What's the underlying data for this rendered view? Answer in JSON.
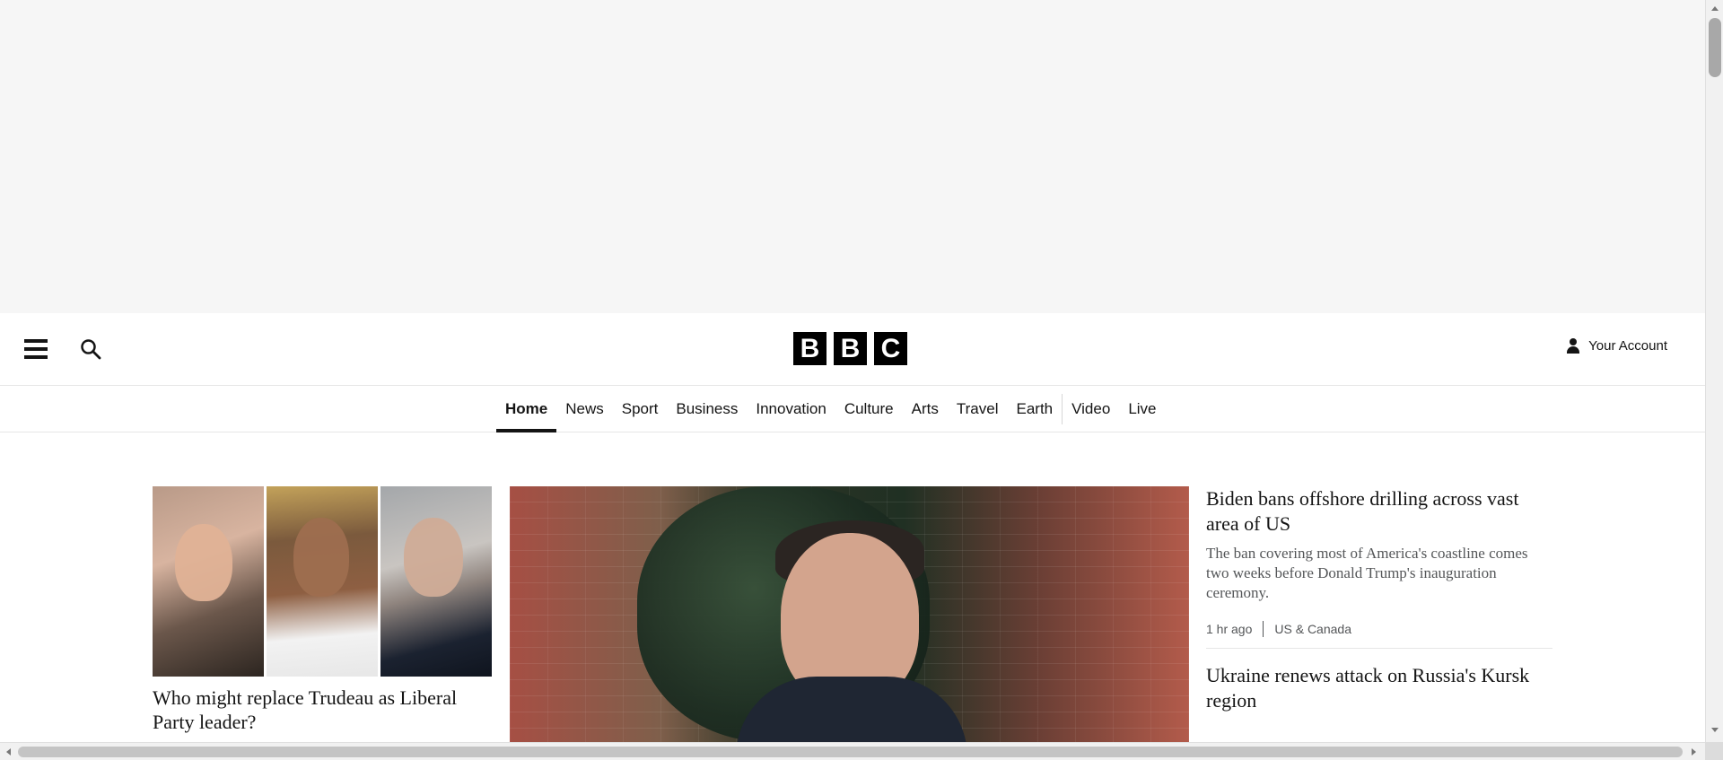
{
  "header": {
    "logo_letters": [
      "B",
      "B",
      "C"
    ],
    "account_label": "Your Account"
  },
  "nav": {
    "items": [
      {
        "label": "Home",
        "active": true
      },
      {
        "label": "News"
      },
      {
        "label": "Sport"
      },
      {
        "label": "Business"
      },
      {
        "label": "Innovation"
      },
      {
        "label": "Culture"
      },
      {
        "label": "Arts"
      },
      {
        "label": "Travel"
      },
      {
        "label": "Earth"
      },
      {
        "label": "Video"
      },
      {
        "label": "Live"
      }
    ]
  },
  "main": {
    "left_story": {
      "headline": "Who might replace Trudeau as Liberal Party leader?"
    },
    "side_stories": [
      {
        "headline": "Biden bans offshore drilling across vast area of US",
        "summary": "The ban covering most of America's coastline comes two weeks before Donald Trump's inauguration ceremony.",
        "time": "1 hr ago",
        "section": "US & Canada"
      },
      {
        "headline": "Ukraine renews attack on Russia's Kursk region"
      }
    ]
  },
  "icons": {
    "menu": "menu-icon",
    "search": "search-icon",
    "account": "person-icon"
  },
  "colors": {
    "ad_background": "#f6f6f6",
    "text": "#141414",
    "secondary_text": "#545658",
    "logo_black": "#000000"
  }
}
